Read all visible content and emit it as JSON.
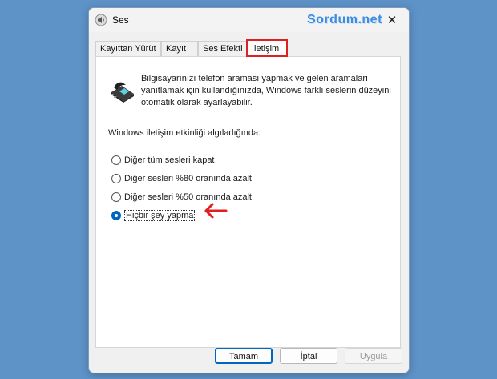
{
  "window": {
    "title": "Ses",
    "watermark": "Sordum.net",
    "close_symbol": "✕"
  },
  "tabs": [
    {
      "label": "Kayıttan Yürüt",
      "active": false
    },
    {
      "label": "Kayıt",
      "active": false
    },
    {
      "label": "Ses Efekti",
      "active": false
    },
    {
      "label": "İletişim",
      "active": true
    }
  ],
  "communications": {
    "description": "Bilgisayarınızı telefon araması yapmak ve gelen aramaları yanıtlamak için kullandığınızda, Windows farklı seslerin düzeyini otomatik olarak ayarlayabilir.",
    "section_label": "Windows iletişim etkinliği algıladığında:",
    "options": [
      {
        "label": "Diğer tüm sesleri kapat",
        "checked": false
      },
      {
        "label": "Diğer sesleri %80 oranında azalt",
        "checked": false
      },
      {
        "label": "Diğer sesleri %50 oranında azalt",
        "checked": false
      },
      {
        "label": "Hiçbir şey yapma",
        "checked": true
      }
    ]
  },
  "buttons": {
    "ok": "Tamam",
    "cancel": "İptal",
    "apply": "Uygula"
  },
  "icons": {
    "title": "speaker-icon",
    "phone": "telephone-icon",
    "annotation": "red-arrow-icon"
  },
  "colors": {
    "desktop": "#5e93c8",
    "accent": "#0067c0",
    "highlight": "#e02020",
    "watermark": "#3d8ce0"
  }
}
